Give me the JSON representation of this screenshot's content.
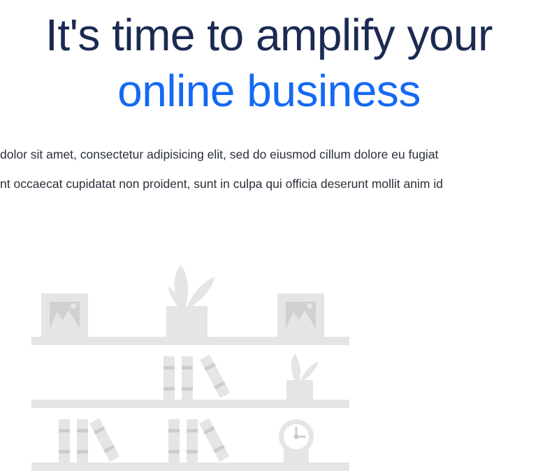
{
  "hero": {
    "title_line_1": "It's time to amplify your",
    "title_line_2": "online business",
    "paragraph_line_1": "dolor sit amet, consectetur adipisicing elit, sed do eiusmod cillum dolore eu fugiat",
    "paragraph_line_2": "nt occaecat cupidatat non proident, sunt in culpa qui officia deserunt mollit anim id"
  },
  "colors": {
    "title_dark": "#1b2a52",
    "title_accent": "#1469f5",
    "body_text": "#2a2f3a",
    "illustration": "#e5e5e5",
    "illustration_detail": "#cccccc"
  },
  "illustration": {
    "icons": [
      "picture-frame-icon",
      "potted-plant-icon",
      "book-icon",
      "clock-icon"
    ]
  }
}
